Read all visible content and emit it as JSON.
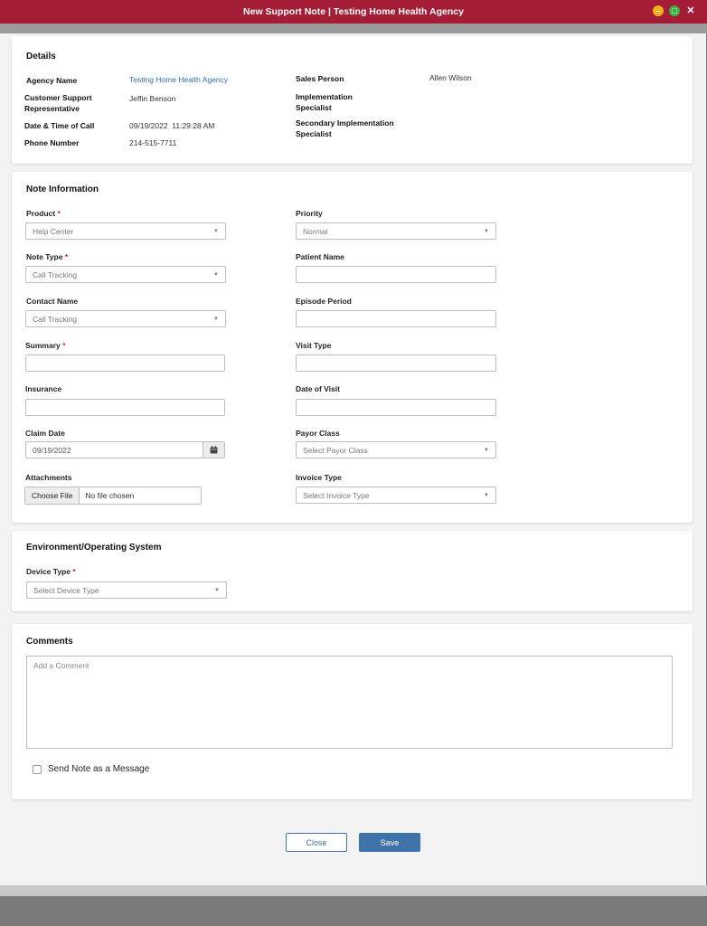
{
  "window": {
    "title": "New Support Note | Testing Home Health Agency",
    "controls": {
      "minimize": "–",
      "maximize": "□",
      "close": "✕"
    }
  },
  "details": {
    "title": "Details",
    "agency_name_label": "Agency Name",
    "agency_name_value": "Testing Home Health Agency",
    "csr_label": "Customer Support Representative",
    "csr_value": "Jeffin Benson",
    "call_time_label": "Date & Time of Call",
    "call_time_value": "09/19/2022  11:29:28 AM",
    "phone_label": "Phone Number",
    "phone_value": "214-515-7711",
    "sales_person_label": "Sales Person",
    "sales_person_value": "Allen Wilson",
    "impl_specialist_label": "Implementation Specialist",
    "secondary_impl_label": "Secondary Implementation Specialist"
  },
  "note_info": {
    "title": "Note Information",
    "product_label": "Product",
    "product_value": "Help Center",
    "note_type_label": "Note Type",
    "note_type_value": "Call Tracking",
    "contact_name_label": "Contact Name",
    "contact_name_value": "Call Tracking",
    "summary_label": "Summary",
    "summary_value": "",
    "insurance_label": "Insurance",
    "insurance_value": "",
    "claim_date_label": "Claim Date",
    "claim_date_value": "09/19/2022",
    "attachments_label": "Attachments",
    "choose_file_label": "Choose File",
    "no_file_text": "No file chosen",
    "priority_label": "Priority",
    "priority_value": "Normal",
    "patient_name_label": "Patient Name",
    "episode_period_label": "Episode Period",
    "visit_type_label": "Visit Type",
    "date_of_visit_label": "Date of Visit",
    "payor_class_label": "Payor Class",
    "payor_class_placeholder": "Select Payor Class",
    "invoice_type_label": "Invoice Type",
    "invoice_type_placeholder": "Select Invoice Type",
    "required_mark": "*"
  },
  "environment": {
    "title": "Environment/Operating System",
    "device_type_label": "Device Type",
    "device_type_placeholder": "Select Device Type"
  },
  "comments": {
    "title": "Comments",
    "placeholder": "Add a Comment",
    "send_as_message_label": "Send Note as a Message",
    "send_as_message_checked": false
  },
  "actions": {
    "close_label": "Close",
    "save_label": "Save"
  },
  "colors": {
    "title_bar": "#a51c36",
    "link": "#2f6fae",
    "primary_button": "#3f72a8",
    "required": "#c0282d"
  },
  "icons": {
    "dropdown": "chevron-down-icon",
    "calendar": "calendar-icon"
  }
}
